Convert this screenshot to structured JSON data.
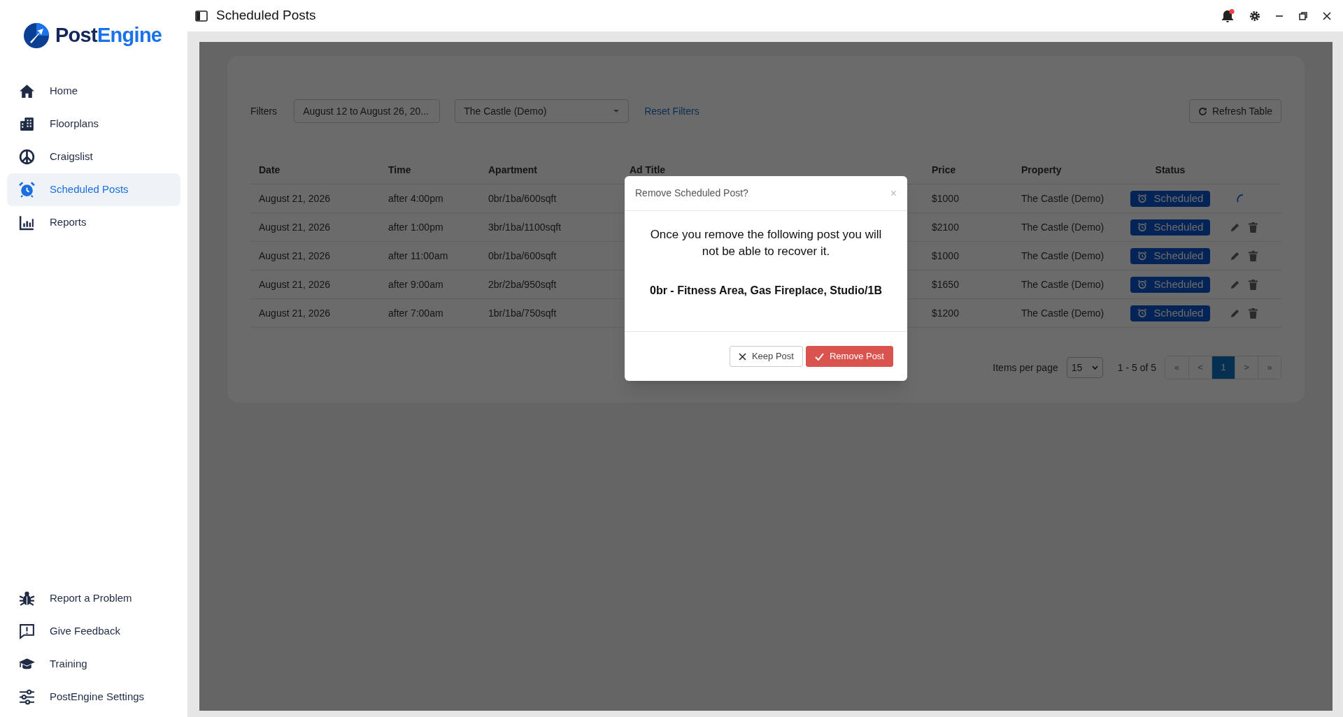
{
  "logo": {
    "text_parts": [
      "Post",
      "Engine"
    ]
  },
  "sidebar": {
    "nav": [
      {
        "label": "Home",
        "kind": "home",
        "selected": false
      },
      {
        "label": "Floorplans",
        "kind": "building",
        "selected": false
      },
      {
        "label": "Craigslist",
        "kind": "peace",
        "selected": false
      },
      {
        "label": "Scheduled Posts",
        "kind": "alarm",
        "selected": true
      },
      {
        "label": "Reports",
        "kind": "chart",
        "selected": false
      }
    ],
    "footer": [
      {
        "label": "Report a Problem",
        "kind": "bug"
      },
      {
        "label": "Give Feedback",
        "kind": "feedback"
      },
      {
        "label": "Training",
        "kind": "graduation"
      },
      {
        "label": "PostEngine Settings",
        "kind": "sliders"
      }
    ]
  },
  "header": {
    "title": "Scheduled Posts",
    "notification": true
  },
  "filters": {
    "label": "Filters",
    "date_range": "August 12 to August 26, 20...",
    "property": "The Castle (Demo)",
    "reset": "Reset Filters",
    "refresh": "Refresh Table"
  },
  "table": {
    "columns": [
      "Date",
      "Time",
      "Apartment",
      "Ad Title",
      "Price",
      "Property",
      "Status"
    ],
    "rows": [
      {
        "date": "August 21, 2026",
        "time": "after 4:00pm",
        "apartment": "0br/1ba/600sqft",
        "price": "$1000",
        "property": "The Castle (Demo)",
        "status": "Scheduled",
        "kind": "loading"
      },
      {
        "date": "August 21, 2026",
        "time": "after 1:00pm",
        "apartment": "3br/1ba/1100sqft",
        "price": "$2100",
        "property": "The Castle (Demo)",
        "status": "Scheduled",
        "kind": "edit_delete"
      },
      {
        "date": "August 21, 2026",
        "time": "after 11:00am",
        "apartment": "0br/1ba/600sqft",
        "price": "$1000",
        "property": "The Castle (Demo)",
        "status": "Scheduled",
        "kind": "edit_delete"
      },
      {
        "date": "August 21, 2026",
        "time": "after 9:00am",
        "apartment": "2br/2ba/950sqft",
        "price": "$1650",
        "property": "The Castle (Demo)",
        "status": "Scheduled",
        "kind": "edit_delete"
      },
      {
        "date": "August 21, 2026",
        "time": "after 7:00am",
        "apartment": "1br/1ba/750sqft",
        "price": "$1200",
        "property": "The Castle (Demo)",
        "status": "Scheduled",
        "kind": "edit_delete"
      }
    ]
  },
  "pagination": {
    "items_per_page_label": "Items per page",
    "per_page": "15",
    "range": "1 - 5 of 5",
    "pages": [
      {
        "label": "«",
        "selected": false,
        "disabled": true
      },
      {
        "label": "<",
        "selected": false,
        "disabled": true
      },
      {
        "label": "1",
        "selected": true,
        "disabled": false
      },
      {
        "label": ">",
        "selected": false,
        "disabled": true
      },
      {
        "label": "»",
        "selected": false,
        "disabled": true
      }
    ]
  },
  "modal": {
    "title": "Remove Scheduled Post?",
    "close": "×",
    "message": "Once you remove the following post you will not be able to recover it.",
    "post_title": "0br - Fitness Area, Gas Fireplace, Studio/1B",
    "buttons": [
      {
        "label": "Keep Post",
        "kind": "cancel"
      },
      {
        "label": "Remove Post",
        "kind": "confirm"
      }
    ]
  }
}
